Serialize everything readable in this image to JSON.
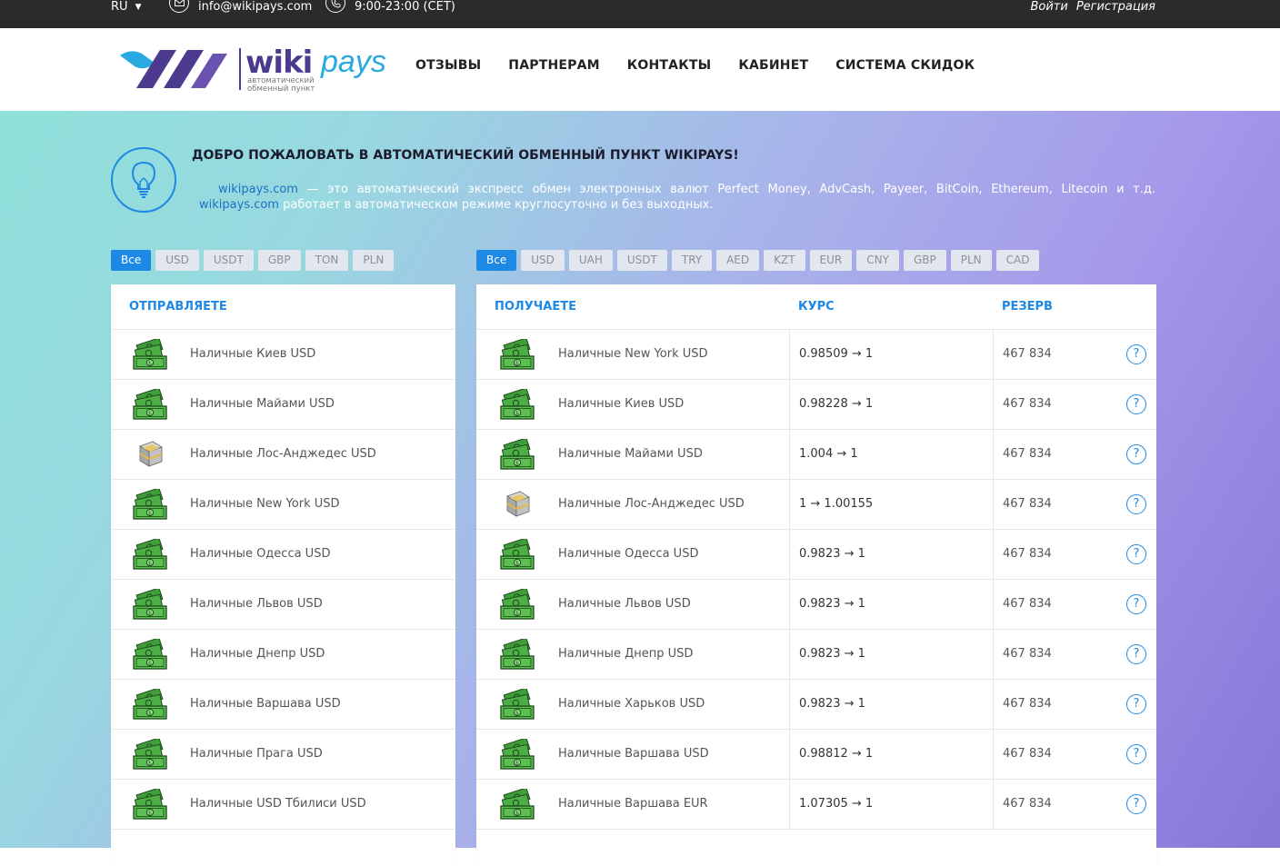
{
  "topbar": {
    "lang": "RU",
    "email": "info@wikipays.com",
    "hours": "9:00-23:00 (CET)",
    "login": "Войти",
    "register": "Регистрация"
  },
  "logo": {
    "wiki": "wiki",
    "pays": "pays",
    "tag1": "автоматический",
    "tag2": "обменный пункт"
  },
  "nav": [
    "ОТЗЫВЫ",
    "ПАРТНЕРАМ",
    "КОНТАКТЫ",
    "КАБИНЕТ",
    "СИСТЕМА СКИДОК"
  ],
  "welcome": {
    "title": "ДОБРО ПОЖАЛОВАТЬ В АВТОМАТИЧЕСКИЙ ОБМЕННЫЙ ПУНКТ WIKIPAYS!",
    "link1": "wikipays.com",
    "text1": " — это автоматический экспресс обмен электронных валют Perfect Money, AdvCash,  Payeer, BitCoin, Ethereum, Litecoin и т.д.  ",
    "link2": "wikipays.com",
    "text2": " работает в автоматическом режиме круглосуточно и без выходных."
  },
  "filters_left": [
    "Все",
    "USD",
    "USDT",
    "GBP",
    "TON",
    "PLN"
  ],
  "filters_right": [
    "Все",
    "USD",
    "UAH",
    "USDT",
    "TRY",
    "AED",
    "KZT",
    "EUR",
    "CNY",
    "GBP",
    "PLN",
    "CAD"
  ],
  "send": {
    "header": "ОТПРАВЛЯЕТЕ",
    "rows": [
      {
        "name": "Наличные Киев USD",
        "icon": "cash-icon"
      },
      {
        "name": "Наличные Майами USD",
        "icon": "cash-icon"
      },
      {
        "name": "Наличные Лос-Анджедес USD",
        "icon": "cash-stack-icon"
      },
      {
        "name": "Наличные New York USD",
        "icon": "cash-icon"
      },
      {
        "name": "Наличные Одесса USD",
        "icon": "cash-icon"
      },
      {
        "name": "Наличные Львов USD",
        "icon": "cash-icon"
      },
      {
        "name": "Наличные Днепр USD",
        "icon": "cash-icon"
      },
      {
        "name": "Наличные Варшава USD",
        "icon": "cash-icon"
      },
      {
        "name": "Наличные Прага USD",
        "icon": "cash-icon"
      },
      {
        "name": "Наличные USD Тбилиси USD",
        "icon": "cash-icon"
      }
    ]
  },
  "receive": {
    "header_get": "ПОЛУЧАЕТЕ",
    "header_rate": "КУРС",
    "header_reserve": "РЕЗЕРВ",
    "rows": [
      {
        "name": "Наличные New York USD",
        "rate": "0.98509 → 1",
        "reserve": "467 834",
        "icon": "cash-icon"
      },
      {
        "name": "Наличные Киев USD",
        "rate": "0.98228 → 1",
        "reserve": "467 834",
        "icon": "cash-icon"
      },
      {
        "name": "Наличные Майами USD",
        "rate": "1.004 → 1",
        "reserve": "467 834",
        "icon": "cash-icon"
      },
      {
        "name": "Наличные Лос-Анджедес USD",
        "rate": "1 → 1.00155",
        "reserve": "467 834",
        "icon": "cash-stack-icon"
      },
      {
        "name": "Наличные Одесса USD",
        "rate": "0.9823 → 1",
        "reserve": "467 834",
        "icon": "cash-icon"
      },
      {
        "name": "Наличные Львов USD",
        "rate": "0.9823 → 1",
        "reserve": "467 834",
        "icon": "cash-icon"
      },
      {
        "name": "Наличные Днепр USD",
        "rate": "0.9823 → 1",
        "reserve": "467 834",
        "icon": "cash-icon"
      },
      {
        "name": "Наличные Харьков USD",
        "rate": "0.9823 → 1",
        "reserve": "467 834",
        "icon": "cash-icon"
      },
      {
        "name": "Наличные Варшава USD",
        "rate": "0.98812 → 1",
        "reserve": "467 834",
        "icon": "cash-icon"
      },
      {
        "name": "Наличные Варшава EUR",
        "rate": "1.07305 → 1",
        "reserve": "467 834",
        "icon": "cash-icon"
      }
    ]
  },
  "help_glyph": "?",
  "colors": {
    "accent": "#1e88e5",
    "topbar": "#2b2b2b",
    "brand_purple": "#4c3a8e",
    "brand_blue": "#29a9e0"
  }
}
